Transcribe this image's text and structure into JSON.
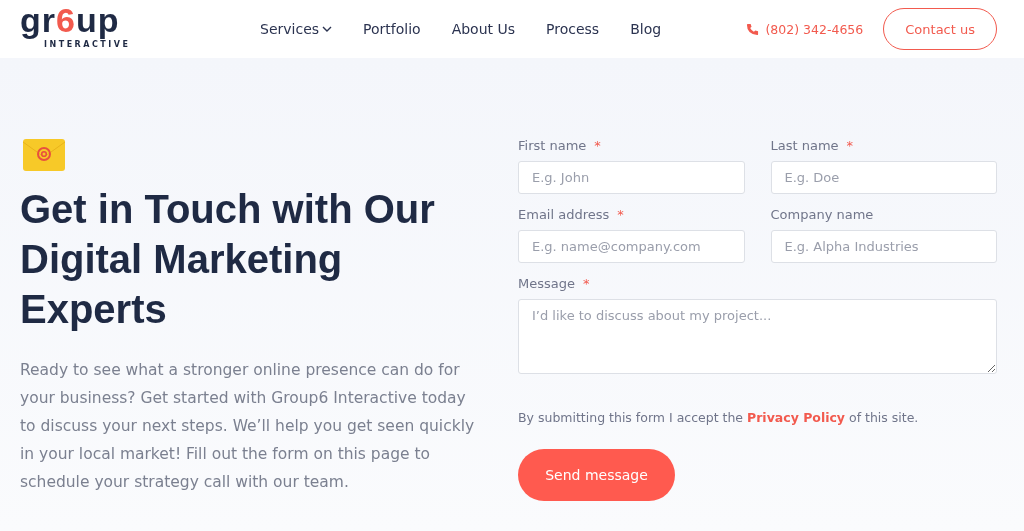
{
  "header": {
    "logo": {
      "wordmark_start": "gr",
      "wordmark_accent": "6",
      "wordmark_end": "up",
      "tagline": "INTERACTIVE"
    },
    "nav": [
      {
        "label": "Services",
        "has_menu": true
      },
      {
        "label": "Portfolio",
        "has_menu": false
      },
      {
        "label": "About Us",
        "has_menu": false
      },
      {
        "label": "Process",
        "has_menu": false
      },
      {
        "label": "Blog",
        "has_menu": false
      }
    ],
    "phone": "(802) 342-4656",
    "contact_button": "Contact us"
  },
  "intro": {
    "heading": "Get in Touch with Our Digital Marketing Experts",
    "text": "Ready to see what a stronger online presence can do for your business? Get started with Group6 Interactive today to discuss your next steps. We’ll help you get seen quickly in your local market! Fill out the form on this page to schedule your strategy call with our team."
  },
  "form": {
    "fields": [
      {
        "label": "First name",
        "required_mark": "*",
        "placeholder": "E.g. John",
        "kind": "text"
      },
      {
        "label": "Last name",
        "required_mark": "*",
        "placeholder": "E.g. Doe",
        "kind": "text"
      },
      {
        "label": "Email address",
        "required_mark": "*",
        "placeholder": "E.g. name@company.com",
        "kind": "text"
      },
      {
        "label": "Company name",
        "placeholder": "E.g. Alpha Industries",
        "kind": "text"
      },
      {
        "label": "Message",
        "required_mark": "*",
        "placeholder": "I’d like to discuss about my project...",
        "kind": "textarea"
      }
    ],
    "consent": {
      "before": "By submitting this form I accept the",
      "link": "Privacy Policy",
      "after": "of this site."
    },
    "submit": "Send message"
  }
}
